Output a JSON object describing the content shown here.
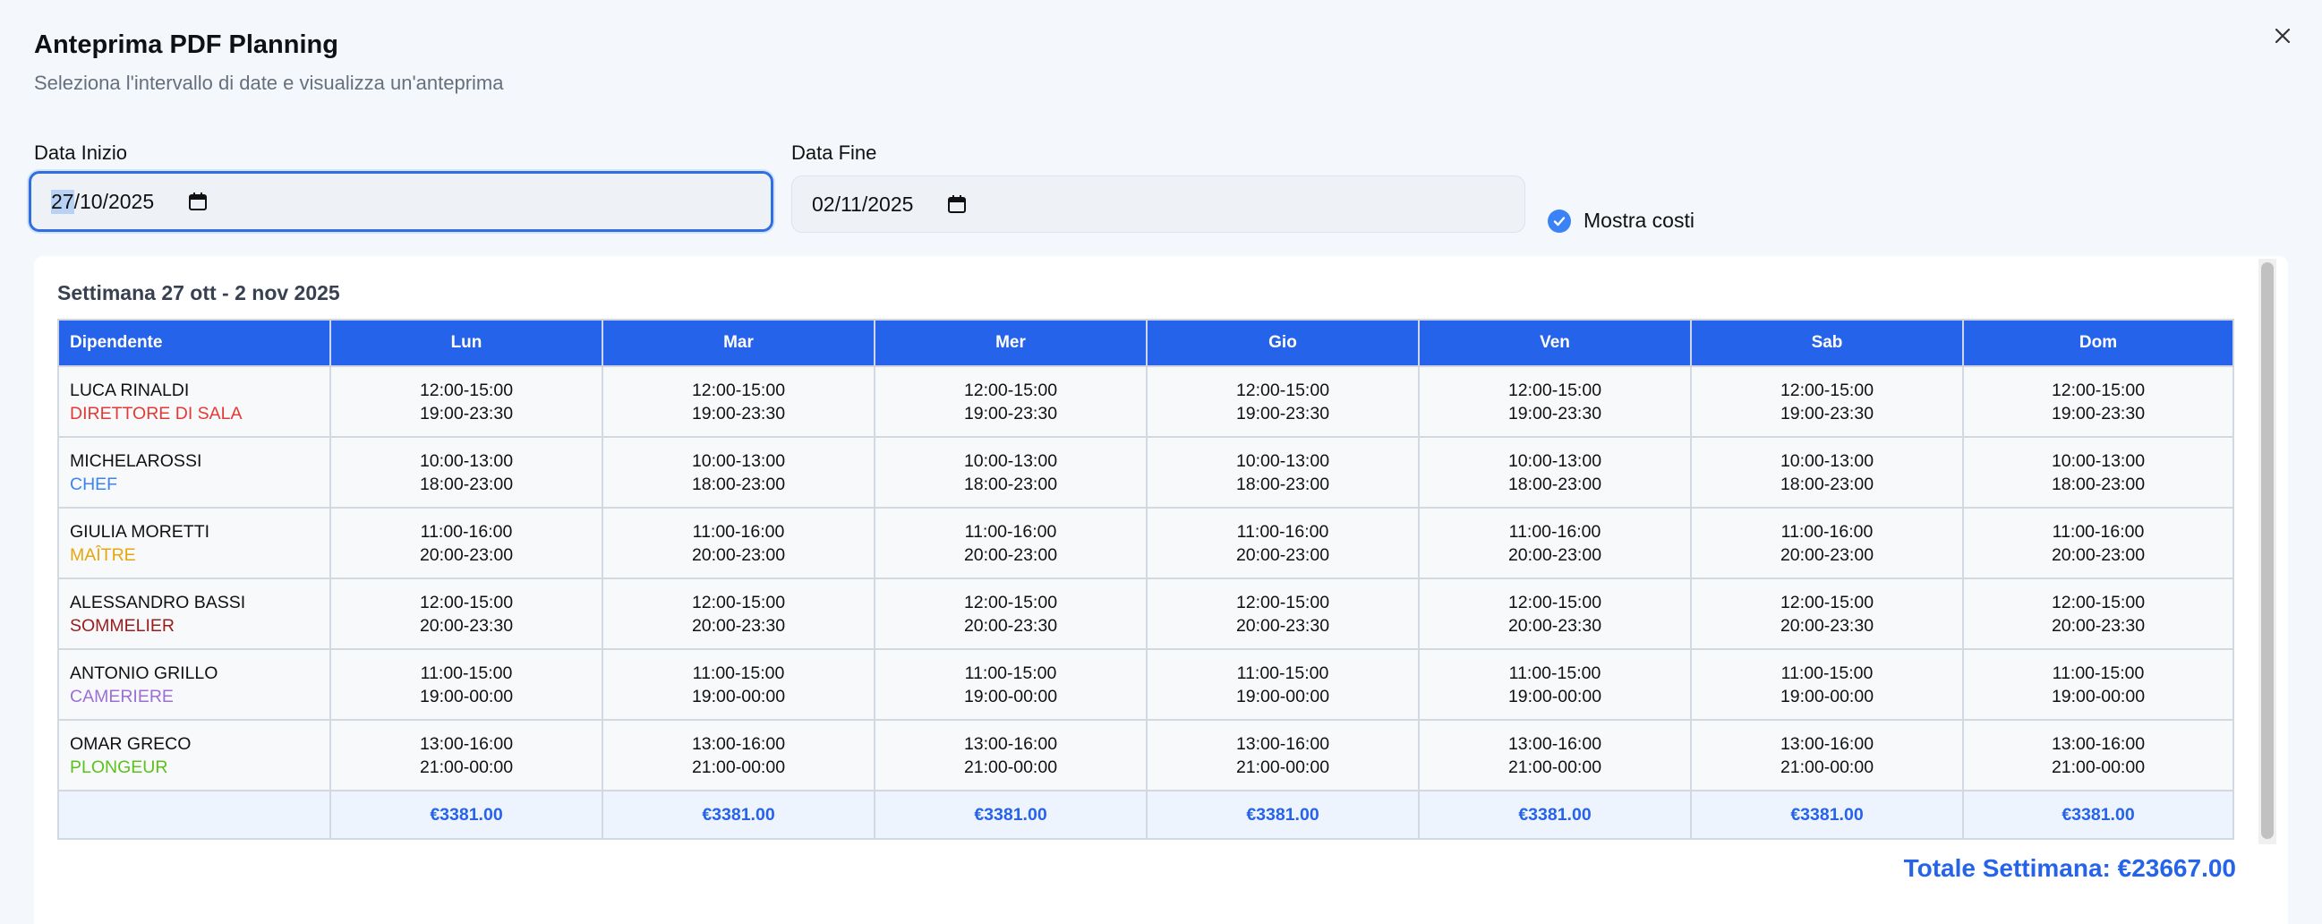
{
  "dialog": {
    "title": "Anteprima PDF Planning",
    "subtitle": "Seleziona l'intervallo di date e visualizza un'anteprima",
    "close_icon": "close-icon"
  },
  "form": {
    "start_label": "Data Inizio",
    "start_day": "27",
    "start_rest": "/10/2025",
    "end_label": "Data Fine",
    "end_value": "02/11/2025",
    "show_costs_label": "Mostra costi",
    "show_costs_checked": true
  },
  "preview": {
    "week_title": "Settimana 27 ott - 2 nov 2025",
    "columns": [
      "Dipendente",
      "Lun",
      "Mar",
      "Mer",
      "Gio",
      "Ven",
      "Sab",
      "Dom"
    ],
    "rows": [
      {
        "name": "LUCA RINALDI",
        "role": "DIRETTORE DI SALA",
        "role_color": "#e53935",
        "shift1": "12:00-15:00",
        "shift2": "19:00-23:30"
      },
      {
        "name": "MICHELAROSSI",
        "role": "CHEF",
        "role_color": "#3b82f6",
        "shift1": "10:00-13:00",
        "shift2": "18:00-23:00"
      },
      {
        "name": "GIULIA MORETTI",
        "role": "MAÎTRE",
        "role_color": "#e8a60c",
        "shift1": "11:00-16:00",
        "shift2": "20:00-23:00"
      },
      {
        "name": "ALESSANDRO BASSI",
        "role": "SOMMELIER",
        "role_color": "#9b1c1c",
        "shift1": "12:00-15:00",
        "shift2": "20:00-23:30"
      },
      {
        "name": "ANTONIO GRILLO",
        "role": "CAMERIERE",
        "role_color": "#9b6fd6",
        "shift1": "11:00-15:00",
        "shift2": "19:00-00:00"
      },
      {
        "name": "OMAR GRECO",
        "role": "PLONGEUR",
        "role_color": "#5cc21a",
        "shift1": "13:00-16:00",
        "shift2": "21:00-00:00"
      }
    ],
    "daily_totals": [
      "€3381.00",
      "€3381.00",
      "€3381.00",
      "€3381.00",
      "€3381.00",
      "€3381.00",
      "€3381.00"
    ],
    "week_total": "Totale Settimana: €23667.00"
  },
  "colors": {
    "accent": "#2563eb",
    "focus": "#2f6fe0"
  }
}
